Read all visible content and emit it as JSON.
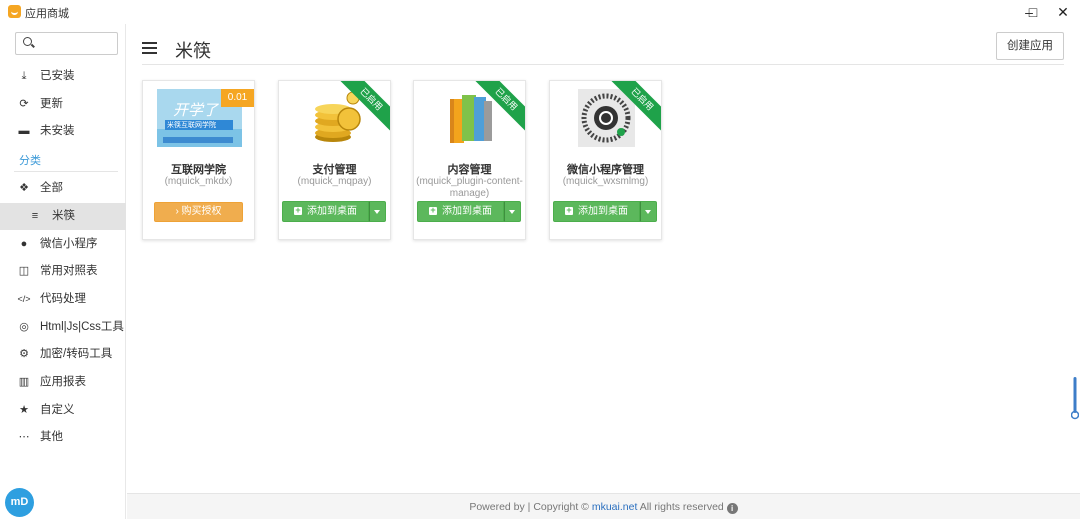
{
  "window": {
    "title": "应用商城",
    "minimize": "–",
    "maximize": "□",
    "close": "✕"
  },
  "search": {
    "placeholder": ""
  },
  "sidebar": {
    "items": [
      {
        "icon": "download-icon",
        "glyph": "⤓",
        "label": "已安装"
      },
      {
        "icon": "refresh-icon",
        "glyph": "⟳",
        "label": "更新"
      },
      {
        "icon": "minus-square-icon",
        "glyph": "▬",
        "label": "未安装"
      }
    ],
    "section_label": "分类",
    "categories": [
      {
        "icon": "cubes-icon",
        "glyph": "❖",
        "label": "全部"
      },
      {
        "icon": "list-icon",
        "glyph": "≡",
        "label": "米筷",
        "active": true
      },
      {
        "icon": "comment-icon",
        "glyph": "●",
        "label": "微信小程序"
      },
      {
        "icon": "columns-icon",
        "glyph": "◫",
        "label": "常用对照表"
      },
      {
        "icon": "code-icon",
        "glyph": "</>",
        "label": "代码处理"
      },
      {
        "icon": "chrome-icon",
        "glyph": "◎",
        "label": "Html|Js|Css工具"
      },
      {
        "icon": "cogs-icon",
        "glyph": "⚙",
        "label": "加密/转码工具"
      },
      {
        "icon": "chart-icon",
        "glyph": "▥",
        "label": "应用报表"
      },
      {
        "icon": "star-icon",
        "glyph": "★",
        "label": "自定义"
      },
      {
        "icon": "ellipsis-icon",
        "glyph": "⋯",
        "label": "其他"
      }
    ],
    "logo_text": "mD"
  },
  "main": {
    "title": "米筷",
    "create_button": "创建应用",
    "cards": [
      {
        "name": "互联网学院",
        "id": "(mquick_mkdx)",
        "badge": "0.01",
        "button": "› 购买授权",
        "enabled": false,
        "thumb_text": "开学了",
        "thumb_sub": "米筷互联网学院"
      },
      {
        "name": "支付管理",
        "id": "(mquick_mqpay)",
        "ribbon": "已启用",
        "button": "添加到桌面",
        "enabled": true
      },
      {
        "name": "内容管理",
        "id": "(mquick_plugin-content-manage)",
        "ribbon": "已启用",
        "button": "添加到桌面",
        "enabled": true
      },
      {
        "name": "微信小程序管理",
        "id": "(mquick_wxsmlmg)",
        "ribbon": "已启用",
        "button": "添加到桌面",
        "enabled": true
      }
    ]
  },
  "footer": {
    "prefix": "Powered by | Copyright ©",
    "link": "mkuai.net",
    "suffix": "All rights reserved"
  },
  "colors": {
    "accent": "#3c9ad8",
    "green": "#5cb85c",
    "orange": "#f0ad4e",
    "ribbon": "#1fa24a"
  }
}
